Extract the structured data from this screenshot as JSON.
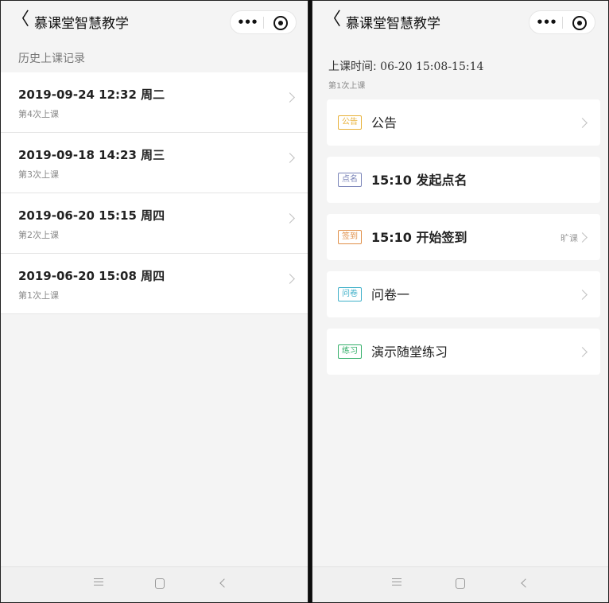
{
  "left_screen": {
    "title": "慕课堂智慧教学",
    "back_glyph": "〈",
    "capsule_more": "•••",
    "section_label": "历史上课记录",
    "history": [
      {
        "date": "2019-09-24 12:32 周二",
        "sub": "第4次上课"
      },
      {
        "date": "2019-09-18 14:23 周三",
        "sub": "第3次上课"
      },
      {
        "date": "2019-06-20 15:15 周四",
        "sub": "第2次上课"
      },
      {
        "date": "2019-06-20 15:08 周四",
        "sub": "第1次上课"
      }
    ]
  },
  "right_screen": {
    "title": "慕课堂智慧教学",
    "back_glyph": "〈",
    "capsule_more": "•••",
    "time_label": "上课时间:",
    "time_value": "06-20 15:08-15:14",
    "session_label": "第1次上课",
    "cards": [
      {
        "tag": "公告",
        "title": "公告",
        "status": "",
        "tag_color": "#e8b23a"
      },
      {
        "tag": "点名",
        "title": "15:10 发起点名",
        "status": "",
        "tag_color": "#7a84b8"
      },
      {
        "tag": "签到",
        "title": "15:10 开始签到",
        "status": "旷课",
        "tag_color": "#e08f48"
      },
      {
        "tag": "问卷",
        "title": "问卷一",
        "status": "",
        "tag_color": "#3fb0c9"
      },
      {
        "tag": "练习",
        "title": "演示随堂练习",
        "status": "",
        "tag_color": "#35b06a"
      }
    ]
  },
  "icons": {
    "back": "back-arrow-icon",
    "more": "more-dots-icon",
    "close": "target-close-icon",
    "chevron": "chevron-right-icon",
    "nav_menu": "menu-icon",
    "nav_home": "home-square-icon",
    "nav_back": "nav-back-icon"
  }
}
